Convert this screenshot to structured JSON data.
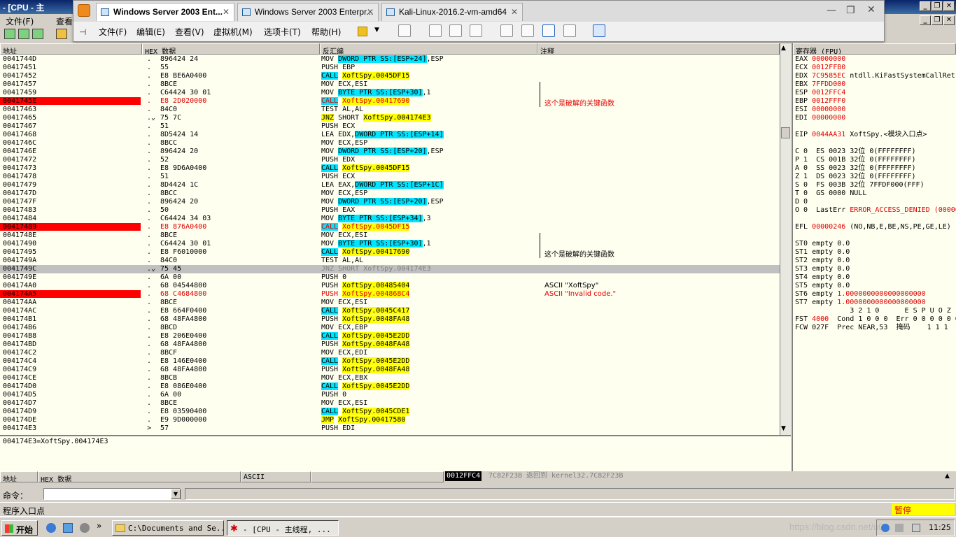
{
  "olly": {
    "title": "- [CPU - 主",
    "menu": [
      "文件(F)",
      "查看"
    ],
    "win_min": "_",
    "win_max": "❐",
    "win_close": "✕"
  },
  "vmware": {
    "tabs": [
      {
        "label": "Windows Server 2003 Ent...",
        "active": true
      },
      {
        "label": "Windows Server 2003 Enterpr...",
        "active": false
      },
      {
        "label": "Kali-Linux-2016.2-vm-amd64",
        "active": false
      }
    ],
    "menu": [
      "文件(F)",
      "编辑(E)",
      "查看(V)",
      "虚拟机(M)",
      "选项卡(T)",
      "帮助(H)"
    ]
  },
  "cpu": {
    "headers": {
      "addr": "地址",
      "hex": "HEX 数据",
      "disasm": "反汇编",
      "comment": "注释"
    },
    "rows": [
      {
        "a": "0041744D",
        "d": ".",
        "h": "896424 24",
        "i": [
          [
            "MOV ",
            ""
          ],
          [
            "DWORD PTR SS:[ESP+24]",
            "c"
          ],
          [
            ",ESP",
            ""
          ]
        ]
      },
      {
        "a": "00417451",
        "d": ".",
        "h": "55",
        "i": [
          [
            "PUSH EBP",
            ""
          ]
        ]
      },
      {
        "a": "00417452",
        "d": ".",
        "h": "E8 BE6A0400",
        "i": [
          [
            "CALL",
            "c"
          ],
          [
            " ",
            ""
          ],
          [
            "XoftSpy.0045DF15",
            "y"
          ]
        ]
      },
      {
        "a": "00417457",
        "d": ".",
        "h": "8BCE",
        "i": [
          [
            "MOV ECX,ESI",
            ""
          ]
        ]
      },
      {
        "a": "00417459",
        "d": ".",
        "h": "C64424 30 01",
        "i": [
          [
            "MOV ",
            ""
          ],
          [
            "BYTE PTR SS:[ESP+30]",
            "c"
          ],
          [
            ",1",
            ""
          ]
        ]
      },
      {
        "a": "0041745E",
        "d": ".",
        "h": "E8 2D020000",
        "i": [
          [
            "CALL",
            "c"
          ],
          [
            " ",
            ""
          ],
          [
            "XoftSpy.00417690",
            "y"
          ]
        ],
        "red": true,
        "cmt": "这个是破解的关键函数"
      },
      {
        "a": "00417463",
        "d": ".",
        "h": "84C0",
        "i": [
          [
            "TEST AL,AL",
            ""
          ]
        ]
      },
      {
        "a": "00417465",
        "d": ".⌄",
        "h": "75 7C",
        "i": [
          [
            "JNZ",
            "y"
          ],
          [
            " SHORT ",
            ""
          ],
          [
            "XoftSpy.004174E3",
            "y"
          ]
        ]
      },
      {
        "a": "00417467",
        "d": ".",
        "h": "51",
        "i": [
          [
            "PUSH ECX",
            ""
          ]
        ]
      },
      {
        "a": "00417468",
        "d": ".",
        "h": "8D5424 14",
        "i": [
          [
            "LEA EDX,",
            ""
          ],
          [
            "DWORD PTR SS:[ESP+14]",
            "c"
          ]
        ]
      },
      {
        "a": "0041746C",
        "d": ".",
        "h": "8BCC",
        "i": [
          [
            "MOV ECX,ESP",
            ""
          ]
        ]
      },
      {
        "a": "0041746E",
        "d": ".",
        "h": "896424 20",
        "i": [
          [
            "MOV ",
            ""
          ],
          [
            "DWORD PTR SS:[ESP+20]",
            "c"
          ],
          [
            ",ESP",
            ""
          ]
        ]
      },
      {
        "a": "00417472",
        "d": ".",
        "h": "52",
        "i": [
          [
            "PUSH EDX",
            ""
          ]
        ]
      },
      {
        "a": "00417473",
        "d": ".",
        "h": "E8 9D6A0400",
        "i": [
          [
            "CALL",
            "c"
          ],
          [
            " ",
            ""
          ],
          [
            "XoftSpy.0045DF15",
            "y"
          ]
        ]
      },
      {
        "a": "00417478",
        "d": ".",
        "h": "51",
        "i": [
          [
            "PUSH ECX",
            ""
          ]
        ]
      },
      {
        "a": "00417479",
        "d": ".",
        "h": "8D4424 1C",
        "i": [
          [
            "LEA EAX,",
            ""
          ],
          [
            "DWORD PTR SS:[ESP+1C]",
            "c"
          ]
        ]
      },
      {
        "a": "0041747D",
        "d": ".",
        "h": "8BCC",
        "i": [
          [
            "MOV ECX,ESP",
            ""
          ]
        ]
      },
      {
        "a": "0041747F",
        "d": ".",
        "h": "896424 20",
        "i": [
          [
            "MOV ",
            ""
          ],
          [
            "DWORD PTR SS:[ESP+20]",
            "c"
          ],
          [
            ",ESP",
            ""
          ]
        ]
      },
      {
        "a": "00417483",
        "d": ".",
        "h": "50",
        "i": [
          [
            "PUSH EAX",
            ""
          ]
        ]
      },
      {
        "a": "00417484",
        "d": ".",
        "h": "C64424 34 03",
        "i": [
          [
            "MOV ",
            ""
          ],
          [
            "BYTE PTR SS:[ESP+34]",
            "c"
          ],
          [
            ",3",
            ""
          ]
        ]
      },
      {
        "a": "00417489",
        "d": ".",
        "h": "E8 876A0400",
        "i": [
          [
            "CALL",
            "c"
          ],
          [
            " ",
            ""
          ],
          [
            "XoftSpy.0045DF15",
            "y"
          ]
        ],
        "red": true
      },
      {
        "a": "0041748E",
        "d": ".",
        "h": "8BCE",
        "i": [
          [
            "MOV ECX,ESI",
            ""
          ]
        ]
      },
      {
        "a": "00417490",
        "d": ".",
        "h": "C64424 30 01",
        "i": [
          [
            "MOV ",
            ""
          ],
          [
            "BYTE PTR SS:[ESP+30]",
            "c"
          ],
          [
            ",1",
            ""
          ]
        ]
      },
      {
        "a": "00417495",
        "d": ".",
        "h": "E8 F6010000",
        "i": [
          [
            "CALL",
            "c"
          ],
          [
            " ",
            ""
          ],
          [
            "XoftSpy.00417690",
            "y"
          ]
        ],
        "cmt": "这个是破解的关键函数"
      },
      {
        "a": "0041749A",
        "d": ".",
        "h": "84C0",
        "i": [
          [
            "TEST AL,AL",
            ""
          ]
        ]
      },
      {
        "a": "0041749C",
        "d": ".⌄",
        "h": "75 45",
        "i": [
          [
            "JNZ SHORT XoftSpy.004174E3",
            "g"
          ]
        ],
        "hl": true
      },
      {
        "a": "0041749E",
        "d": ".",
        "h": "6A 00",
        "i": [
          [
            "PUSH 0",
            ""
          ]
        ]
      },
      {
        "a": "004174A0",
        "d": ".",
        "h": "68 04544800",
        "i": [
          [
            "PUSH ",
            ""
          ],
          [
            "XoftSpy.00485404",
            "y"
          ]
        ],
        "cmt": "ASCII \"XoftSpy\""
      },
      {
        "a": "004174A5",
        "d": ".",
        "h": "68 C4684800",
        "i": [
          [
            "PUSH ",
            ""
          ],
          [
            "XoftSpy.004868C4",
            "y"
          ]
        ],
        "red": true,
        "cmt": "ASCII \"Invalid code.\""
      },
      {
        "a": "004174AA",
        "d": ".",
        "h": "8BCE",
        "i": [
          [
            "MOV ECX,ESI",
            ""
          ]
        ]
      },
      {
        "a": "004174AC",
        "d": ".",
        "h": "E8 664F0400",
        "i": [
          [
            "CALL",
            "c"
          ],
          [
            " ",
            ""
          ],
          [
            "XoftSpy.0045C417",
            "y"
          ]
        ]
      },
      {
        "a": "004174B1",
        "d": ".",
        "h": "68 48FA4800",
        "i": [
          [
            "PUSH ",
            ""
          ],
          [
            "XoftSpy.0048FA48",
            "y"
          ]
        ]
      },
      {
        "a": "004174B6",
        "d": ".",
        "h": "8BCD",
        "i": [
          [
            "MOV ECX,EBP",
            ""
          ]
        ]
      },
      {
        "a": "004174B8",
        "d": ".",
        "h": "E8 206E0400",
        "i": [
          [
            "CALL",
            "c"
          ],
          [
            " ",
            ""
          ],
          [
            "XoftSpy.0045E2DD",
            "y"
          ]
        ]
      },
      {
        "a": "004174BD",
        "d": ".",
        "h": "68 48FA4800",
        "i": [
          [
            "PUSH ",
            ""
          ],
          [
            "XoftSpy.0048FA48",
            "y"
          ]
        ]
      },
      {
        "a": "004174C2",
        "d": ".",
        "h": "8BCF",
        "i": [
          [
            "MOV ECX,EDI",
            ""
          ]
        ]
      },
      {
        "a": "004174C4",
        "d": ".",
        "h": "E8 146E0400",
        "i": [
          [
            "CALL",
            "c"
          ],
          [
            " ",
            ""
          ],
          [
            "XoftSpy.0045E2DD",
            "y"
          ]
        ]
      },
      {
        "a": "004174C9",
        "d": ".",
        "h": "68 48FA4800",
        "i": [
          [
            "PUSH ",
            ""
          ],
          [
            "XoftSpy.0048FA48",
            "y"
          ]
        ]
      },
      {
        "a": "004174CE",
        "d": ".",
        "h": "8BCB",
        "i": [
          [
            "MOV ECX,EBX",
            ""
          ]
        ]
      },
      {
        "a": "004174D0",
        "d": ".",
        "h": "E8 086E0400",
        "i": [
          [
            "CALL",
            "c"
          ],
          [
            " ",
            ""
          ],
          [
            "XoftSpy.0045E2DD",
            "y"
          ]
        ]
      },
      {
        "a": "004174D5",
        "d": ".",
        "h": "6A 00",
        "i": [
          [
            "PUSH 0",
            ""
          ]
        ]
      },
      {
        "a": "004174D7",
        "d": ".",
        "h": "8BCE",
        "i": [
          [
            "MOV ECX,ESI",
            ""
          ]
        ]
      },
      {
        "a": "004174D9",
        "d": ".",
        "h": "E8 03590400",
        "i": [
          [
            "CALL",
            "c"
          ],
          [
            " ",
            ""
          ],
          [
            "XoftSpy.0045CDE1",
            "y"
          ]
        ]
      },
      {
        "a": "004174DE",
        "d": ".",
        "h": "E9 9D000000",
        "i": [
          [
            "JMP",
            "y"
          ],
          [
            " ",
            ""
          ],
          [
            "XoftSpy.00417580",
            "y"
          ]
        ]
      },
      {
        "a": "004174E3",
        "d": ">",
        "h": "57",
        "i": [
          [
            "PUSH EDI",
            ""
          ]
        ]
      }
    ],
    "info": "004174E3=XoftSpy.004174E3"
  },
  "regs": {
    "title": "寄存器 (FPU)",
    "lines": [
      [
        "EAX ",
        "00000000",
        ""
      ],
      [
        "ECX ",
        "0012FFB0",
        ""
      ],
      [
        "EDX ",
        "7C9585EC",
        " ntdll.KiFastSystemCallRet"
      ],
      [
        "EBX ",
        "7FFDD000",
        ""
      ],
      [
        "ESP ",
        "0012FFC4",
        ""
      ],
      [
        "EBP ",
        "0012FFF0",
        ""
      ],
      [
        "ESI ",
        "00000000",
        ""
      ],
      [
        "EDI ",
        "00000000",
        ""
      ],
      [
        "",
        "",
        ""
      ],
      [
        "EIP ",
        "0044AA31",
        " XoftSpy.<模块入口点>"
      ],
      [
        "",
        "",
        ""
      ],
      [
        "C 0  ES 0023 32位 0(FFFFFFFF)",
        "",
        ""
      ],
      [
        "P 1  CS 001B 32位 0(FFFFFFFF)",
        "",
        ""
      ],
      [
        "A 0  SS 0023 32位 0(FFFFFFFF)",
        "",
        ""
      ],
      [
        "Z 1  DS 0023 32位 0(FFFFFFFF)",
        "",
        ""
      ],
      [
        "S 0  FS 003B 32位 7FFDF000(FFF)",
        "",
        ""
      ],
      [
        "T 0  GS 0000 NULL",
        "",
        ""
      ],
      [
        "D 0",
        "",
        ""
      ],
      [
        "O 0  LastErr ",
        "ERROR_ACCESS_DENIED (00000",
        ""
      ],
      [
        "",
        "",
        ""
      ],
      [
        "EFL ",
        "00000246",
        " (NO,NB,E,BE,NS,PE,GE,LE)"
      ],
      [
        "",
        "",
        ""
      ],
      [
        "ST0 empty 0.0",
        "",
        ""
      ],
      [
        "ST1 empty 0.0",
        "",
        ""
      ],
      [
        "ST2 empty 0.0",
        "",
        ""
      ],
      [
        "ST3 empty 0.0",
        "",
        ""
      ],
      [
        "ST4 empty 0.0",
        "",
        ""
      ],
      [
        "ST5 empty 0.0",
        "",
        ""
      ],
      [
        "ST6 empty ",
        "1.0000000000000000000",
        ""
      ],
      [
        "ST7 empty ",
        "1.0000000000000000000",
        ""
      ],
      [
        "             3 2 1 0      E S P U O Z",
        "",
        ""
      ],
      [
        "FST ",
        "4000",
        "  Cond 1 0 0 0  Err 0 0 0 0 0 0"
      ],
      [
        "FCW 027F  Prec NEAR,53  掩码    1 1 1",
        "",
        ""
      ]
    ]
  },
  "dump": {
    "headers": [
      "地址",
      "HEX 数据",
      "ASCII"
    ],
    "stack_addr": "0012FFC4",
    "stack_val": "7C82F23B",
    "stack_cmt": "返回到 kernel32.7C82F23B"
  },
  "command": {
    "label": "命令：",
    "value": ""
  },
  "status": {
    "left": "程序入口点",
    "right": "暂停"
  },
  "taskbar": {
    "start": "开始",
    "items": [
      "C:\\Documents and Se...",
      "- [CPU - 主线程, ..."
    ],
    "clock": "11:25",
    "watermark": "https://blog.csdn.net/u0..."
  }
}
